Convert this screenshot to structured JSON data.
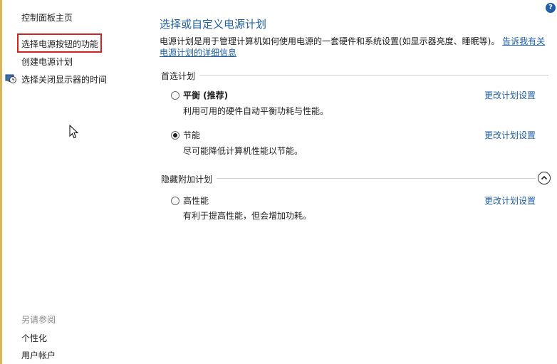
{
  "nav": {
    "home": "控制面板主页",
    "items": [
      {
        "label": "选择电源按钮的功能"
      },
      {
        "label": "创建电源计划"
      },
      {
        "label": "选择关闭显示器的时间"
      }
    ],
    "see_also_title": "另请参阅",
    "see_also": [
      {
        "label": "个性化"
      },
      {
        "label": "用户帐户"
      }
    ]
  },
  "main": {
    "title": "选择或自定义电源计划",
    "description": "电源计划是用于管理计算机如何使用电源的一套硬件和系统设置(如显示器亮度、睡眠等)。",
    "description_link": "告诉我有关电源计划的详细信息"
  },
  "preferred": {
    "label": "首选计划",
    "plans": [
      {
        "name": "平衡 (推荐)",
        "desc": "利用可用的硬件自动平衡功耗与性能。",
        "link": "更改计划设置",
        "selected": false
      },
      {
        "name": "节能",
        "desc": "尽可能降低计算机性能以节能。",
        "link": "更改计划设置",
        "selected": true
      }
    ]
  },
  "hidden": {
    "label": "隐藏附加计划",
    "plans": [
      {
        "name": "高性能",
        "desc": "有利于提高性能，但会增加功耗。",
        "link": "更改计划设置",
        "selected": false
      }
    ]
  },
  "help": {
    "glyph": "?"
  },
  "colors": {
    "accent": "#1f5fa8",
    "highlight_border": "#d42222"
  }
}
